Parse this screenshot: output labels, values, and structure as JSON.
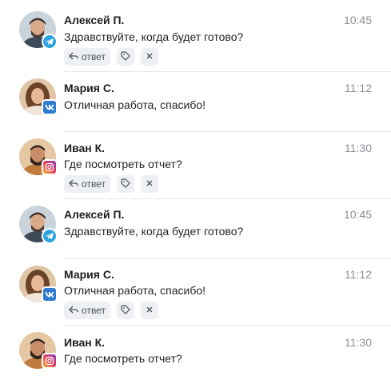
{
  "messages": [
    {
      "name": "Алексей П.",
      "time": "10:45",
      "text": "Здравствуйте, когда будет готово?",
      "source": "telegram-icon",
      "avatar": "man-a",
      "actions": true
    },
    {
      "name": "Мария С.",
      "time": "11:12",
      "text": "Отличная работа, спасибо!",
      "source": "vk-icon",
      "avatar": "woman",
      "actions": false
    },
    {
      "name": "Иван К.",
      "time": "11:30",
      "text": "Где посмотреть отчет?",
      "source": "instagram-icon",
      "avatar": "man-b",
      "actions": true
    },
    {
      "name": "Алексей П.",
      "time": "10:45",
      "text": "Здравствуйте, когда будет готово?",
      "source": "telegram-icon",
      "avatar": "man-a",
      "actions": false
    },
    {
      "name": "Мария С.",
      "time": "11:12",
      "text": "Отличная работа, спасибо!",
      "source": "vk-icon",
      "avatar": "woman",
      "actions": true
    },
    {
      "name": "Иван К.",
      "time": "11:30",
      "text": "Где посмотреть отчет?",
      "source": "instagram-icon",
      "avatar": "man-b",
      "actions": false
    }
  ],
  "actions": {
    "reply_label": "ответ"
  },
  "colors": {
    "telegram": "#2aa3df",
    "vk": "#2f7bd1",
    "chip_bg": "#eef0f3"
  }
}
